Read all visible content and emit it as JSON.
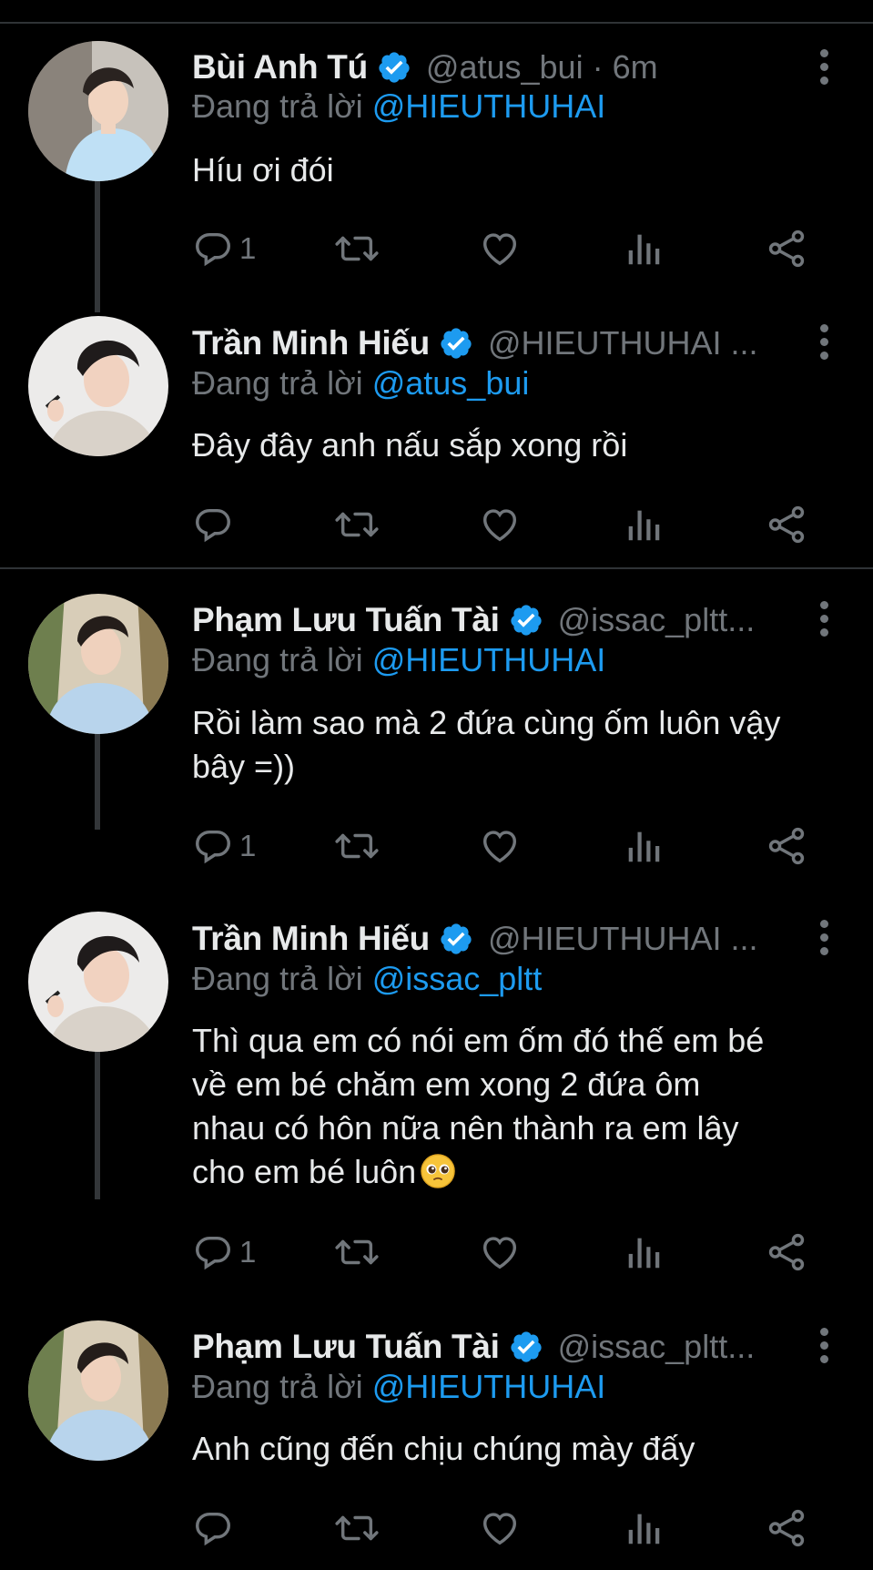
{
  "tweets": [
    {
      "name": "Bùi Anh Tú",
      "handle": "@atus_bui · 6m",
      "reply_prefix": "Đang trả lời",
      "reply_to": "@HIEUTHUHAI",
      "text": "Híu ơi đói",
      "reply_count": "1",
      "avatar": "avatar-bui-anh-tu"
    },
    {
      "name": "Trần Minh Hiếu",
      "handle": "@HIEUTHUHAI ...",
      "reply_prefix": "Đang trả lời",
      "reply_to": "@atus_bui",
      "text": "Đây đây anh nấu sắp xong rồi",
      "reply_count": "",
      "avatar": "avatar-tran-minh-hieu"
    },
    {
      "name": "Phạm Lưu Tuấn Tài",
      "handle": "@issac_pltt...",
      "reply_prefix": "Đang trả lời",
      "reply_to": "@HIEUTHUHAI",
      "text_lines": [
        "Rồi làm sao mà 2 đứa cùng ốm luôn vậy",
        "bây =))"
      ],
      "reply_count": "1",
      "avatar": "avatar-pham-luu-tuan-tai"
    },
    {
      "name": "Trần Minh Hiếu",
      "handle": "@HIEUTHUHAI ...",
      "reply_prefix": "Đang trả lời",
      "reply_to": "@issac_pltt",
      "text_lines": [
        "Thì qua em có nói em ốm đó thế em bé",
        "về em bé chăm em xong 2 đứa ôm",
        "nhau có hôn nữa nên thành ra em lây",
        "cho em bé luôn"
      ],
      "emoji": "pleading-face-emoji",
      "reply_count": "1",
      "avatar": "avatar-tran-minh-hieu"
    },
    {
      "name": "Phạm Lưu Tuấn Tài",
      "handle": "@issac_pltt...",
      "reply_prefix": "Đang trả lời",
      "reply_to": "@HIEUTHUHAI",
      "text": "Anh cũng đến chịu chúng mày đấy",
      "reply_count": "",
      "avatar": "avatar-pham-luu-tuan-tai"
    }
  ],
  "icons": {
    "reply": "reply-icon",
    "retweet": "retweet-icon",
    "like": "heart-icon",
    "views": "views-icon",
    "share": "share-icon",
    "verified": "verified-badge-icon",
    "more": "more-options-icon"
  },
  "colors": {
    "background": "#000000",
    "text": "#e7e9ea",
    "muted": "#71767b",
    "accent": "#1d9bf0",
    "divider": "#2f3336"
  }
}
